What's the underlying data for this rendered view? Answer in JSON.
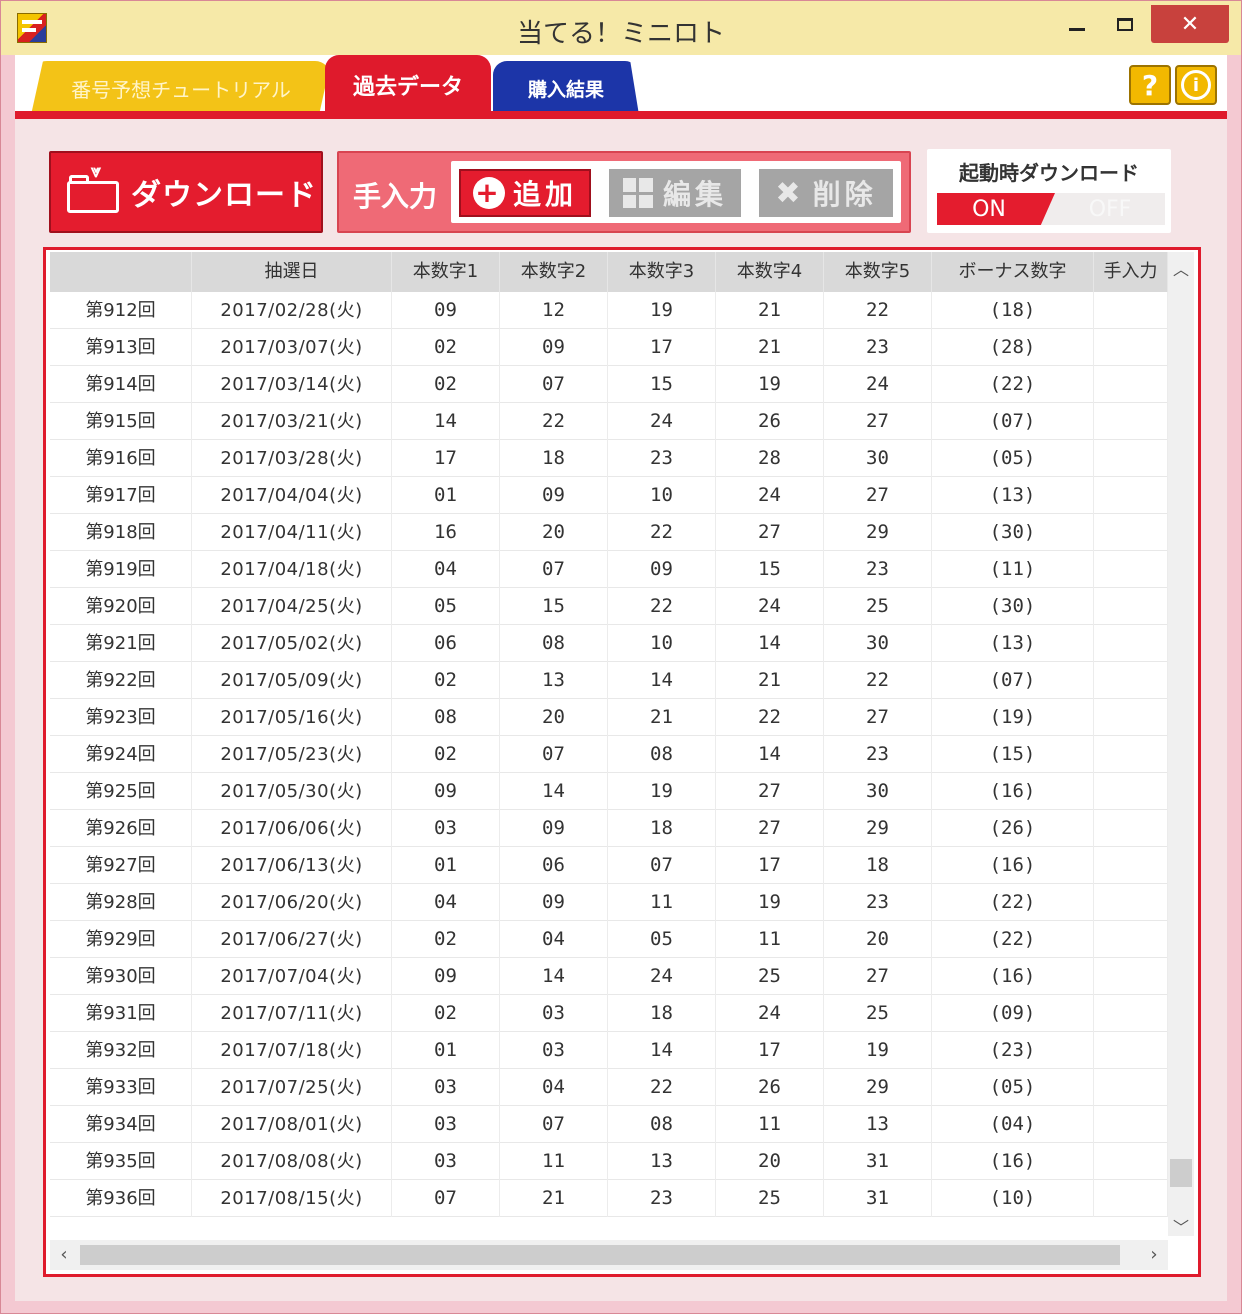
{
  "window": {
    "title": "当てる！ミニロト"
  },
  "tabs": [
    {
      "label": "番号予想チュートリアル"
    },
    {
      "label": "過去データ"
    },
    {
      "label": "購入結果"
    }
  ],
  "help": {
    "help_label": "?",
    "info_label": "i"
  },
  "toolbar": {
    "download_label": "ダウンロード",
    "manual_label": "手入力",
    "add_label": "追加",
    "edit_label": "編集",
    "delete_label": "削除",
    "startup_label": "起動時ダウンロード",
    "toggle_on": "ON",
    "toggle_off": "OFF"
  },
  "table": {
    "headers": [
      "",
      "抽選日",
      "本数字1",
      "本数字2",
      "本数字3",
      "本数字4",
      "本数字5",
      "ボーナス数字",
      "手入力"
    ],
    "rows": [
      [
        "第912回",
        "2017/02/28(火)",
        "09",
        "12",
        "19",
        "21",
        "22",
        "(18)",
        ""
      ],
      [
        "第913回",
        "2017/03/07(火)",
        "02",
        "09",
        "17",
        "21",
        "23",
        "(28)",
        ""
      ],
      [
        "第914回",
        "2017/03/14(火)",
        "02",
        "07",
        "15",
        "19",
        "24",
        "(22)",
        ""
      ],
      [
        "第915回",
        "2017/03/21(火)",
        "14",
        "22",
        "24",
        "26",
        "27",
        "(07)",
        ""
      ],
      [
        "第916回",
        "2017/03/28(火)",
        "17",
        "18",
        "23",
        "28",
        "30",
        "(05)",
        ""
      ],
      [
        "第917回",
        "2017/04/04(火)",
        "01",
        "09",
        "10",
        "24",
        "27",
        "(13)",
        ""
      ],
      [
        "第918回",
        "2017/04/11(火)",
        "16",
        "20",
        "22",
        "27",
        "29",
        "(30)",
        ""
      ],
      [
        "第919回",
        "2017/04/18(火)",
        "04",
        "07",
        "09",
        "15",
        "23",
        "(11)",
        ""
      ],
      [
        "第920回",
        "2017/04/25(火)",
        "05",
        "15",
        "22",
        "24",
        "25",
        "(30)",
        ""
      ],
      [
        "第921回",
        "2017/05/02(火)",
        "06",
        "08",
        "10",
        "14",
        "30",
        "(13)",
        ""
      ],
      [
        "第922回",
        "2017/05/09(火)",
        "02",
        "13",
        "14",
        "21",
        "22",
        "(07)",
        ""
      ],
      [
        "第923回",
        "2017/05/16(火)",
        "08",
        "20",
        "21",
        "22",
        "27",
        "(19)",
        ""
      ],
      [
        "第924回",
        "2017/05/23(火)",
        "02",
        "07",
        "08",
        "14",
        "23",
        "(15)",
        ""
      ],
      [
        "第925回",
        "2017/05/30(火)",
        "09",
        "14",
        "19",
        "27",
        "30",
        "(16)",
        ""
      ],
      [
        "第926回",
        "2017/06/06(火)",
        "03",
        "09",
        "18",
        "27",
        "29",
        "(26)",
        ""
      ],
      [
        "第927回",
        "2017/06/13(火)",
        "01",
        "06",
        "07",
        "17",
        "18",
        "(16)",
        ""
      ],
      [
        "第928回",
        "2017/06/20(火)",
        "04",
        "09",
        "11",
        "19",
        "23",
        "(22)",
        ""
      ],
      [
        "第929回",
        "2017/06/27(火)",
        "02",
        "04",
        "05",
        "11",
        "20",
        "(22)",
        ""
      ],
      [
        "第930回",
        "2017/07/04(火)",
        "09",
        "14",
        "24",
        "25",
        "27",
        "(16)",
        ""
      ],
      [
        "第931回",
        "2017/07/11(火)",
        "02",
        "03",
        "18",
        "24",
        "25",
        "(09)",
        ""
      ],
      [
        "第932回",
        "2017/07/18(火)",
        "01",
        "03",
        "14",
        "17",
        "19",
        "(23)",
        ""
      ],
      [
        "第933回",
        "2017/07/25(火)",
        "03",
        "04",
        "22",
        "26",
        "29",
        "(05)",
        ""
      ],
      [
        "第934回",
        "2017/08/01(火)",
        "03",
        "07",
        "08",
        "11",
        "13",
        "(04)",
        ""
      ],
      [
        "第935回",
        "2017/08/08(火)",
        "03",
        "11",
        "13",
        "20",
        "31",
        "(16)",
        ""
      ],
      [
        "第936回",
        "2017/08/15(火)",
        "07",
        "21",
        "23",
        "25",
        "31",
        "(10)",
        ""
      ]
    ]
  },
  "scroll": {
    "vertical_position": 0.97,
    "horizontal_position": 0.0
  }
}
